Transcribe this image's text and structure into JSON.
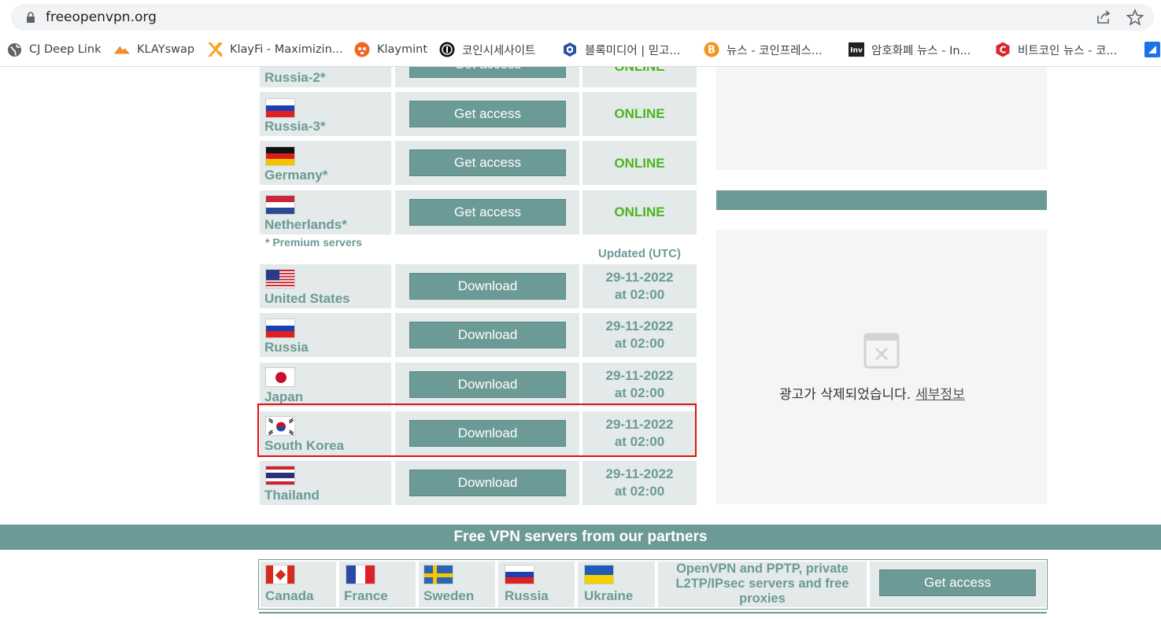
{
  "browser": {
    "url": "freeopenvpn.org",
    "bookmarks": [
      {
        "label": "CJ Deep Link",
        "icon": "globe-icon"
      },
      {
        "label": "KLAYswap",
        "icon": "klayswap-icon"
      },
      {
        "label": "KlayFi - Maximizin...",
        "icon": "klayfi-icon"
      },
      {
        "label": "Klaymint",
        "icon": "klaymint-icon"
      },
      {
        "label": "코인시세사이트",
        "icon": "coin-site-icon"
      },
      {
        "label": "블록미디어 | 믿고...",
        "icon": "blockmedia-icon"
      },
      {
        "label": "뉴스 - 코인프레스...",
        "icon": "bitcoin-icon"
      },
      {
        "label": "암호화폐 뉴스 - In...",
        "icon": "inv-icon"
      },
      {
        "label": "비트코인 뉴스 - 코...",
        "icon": "coinness-icon"
      }
    ],
    "colors": {
      "chrome_bg": "#ffffff",
      "omnibox_bg": "#f1f3f4"
    }
  },
  "premium": {
    "rows": [
      {
        "country": "Russia-2*",
        "flag": "russia-flag",
        "button": "Get access",
        "status": "ONLINE"
      },
      {
        "country": "Russia-3*",
        "flag": "russia-flag",
        "button": "Get access",
        "status": "ONLINE"
      },
      {
        "country": "Germany*",
        "flag": "germany-flag",
        "button": "Get access",
        "status": "ONLINE"
      },
      {
        "country": "Netherlands*",
        "flag": "netherlands-flag",
        "button": "Get access",
        "status": "ONLINE"
      }
    ],
    "note": "* Premium servers"
  },
  "free": {
    "updated_header": "Updated (UTC)",
    "rows": [
      {
        "country": "United States",
        "flag": "usa-flag",
        "button": "Download",
        "date": "29-11-2022",
        "time": "at 02:00"
      },
      {
        "country": "Russia",
        "flag": "russia-flag",
        "button": "Download",
        "date": "29-11-2022",
        "time": "at 02:00"
      },
      {
        "country": "Japan",
        "flag": "japan-flag",
        "button": "Download",
        "date": "29-11-2022",
        "time": "at 02:00"
      },
      {
        "country": "South Korea",
        "flag": "south-korea-flag",
        "button": "Download",
        "date": "29-11-2022",
        "time": "at 02:00"
      },
      {
        "country": "Thailand",
        "flag": "thailand-flag",
        "button": "Download",
        "date": "29-11-2022",
        "time": "at 02:00"
      }
    ],
    "highlighted_row": "South Korea"
  },
  "ad": {
    "text": "광고가 삭제되었습니다.",
    "link": "세부정보",
    "icon": "ad-removed-icon"
  },
  "partners": {
    "title": "Free VPN servers from our partners",
    "countries": [
      {
        "name": "Canada",
        "flag": "canada-flag"
      },
      {
        "name": "France",
        "flag": "france-flag"
      },
      {
        "name": "Sweden",
        "flag": "sweden-flag"
      },
      {
        "name": "Russia",
        "flag": "russia-flag"
      },
      {
        "name": "Ukraine",
        "flag": "ukraine-flag"
      }
    ],
    "desc_lines": [
      "OpenVPN and PPTP, private",
      "L2TP/IPsec servers and free",
      "proxies"
    ],
    "button": "Get access"
  },
  "colors": {
    "accent": "#6c9a96",
    "cell_bg": "#e3eae9",
    "online": "#4bb51d",
    "highlight": "#e21010"
  }
}
